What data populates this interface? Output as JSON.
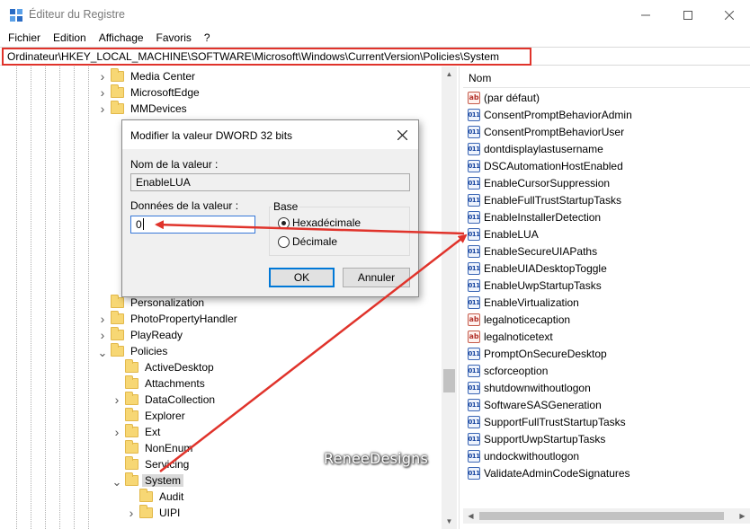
{
  "window": {
    "title": "Éditeur du Registre",
    "icons": {
      "app": "registry-editor-icon",
      "minimize": "minimize-icon",
      "maximize": "maximize-icon",
      "close": "close-icon"
    }
  },
  "menu": [
    "Fichier",
    "Edition",
    "Affichage",
    "Favoris",
    "?"
  ],
  "address": {
    "path": "Ordinateur\\HKEY_LOCAL_MACHINE\\SOFTWARE\\Microsoft\\Windows\\CurrentVersion\\Policies\\System"
  },
  "tree": {
    "items": [
      {
        "label": "Media Center",
        "expander": "collapsed",
        "selected": false
      },
      {
        "label": "MicrosoftEdge",
        "expander": "collapsed",
        "selected": false
      },
      {
        "label": "MMDevices",
        "expander": "collapsed",
        "selected": false
      },
      {
        "label": "Personalization",
        "expander": "none",
        "selected": false
      },
      {
        "label": "PhotoPropertyHandler",
        "expander": "collapsed",
        "selected": false
      },
      {
        "label": "PlayReady",
        "expander": "collapsed",
        "selected": false
      },
      {
        "label": "Policies",
        "expander": "expanded",
        "selected": false
      },
      {
        "label": "ActiveDesktop",
        "expander": "none",
        "selected": false
      },
      {
        "label": "Attachments",
        "expander": "none",
        "selected": false
      },
      {
        "label": "DataCollection",
        "expander": "collapsed",
        "selected": false
      },
      {
        "label": "Explorer",
        "expander": "none",
        "selected": false
      },
      {
        "label": "Ext",
        "expander": "collapsed",
        "selected": false
      },
      {
        "label": "NonEnum",
        "expander": "none",
        "selected": false
      },
      {
        "label": "Servicing",
        "expander": "none",
        "selected": false
      },
      {
        "label": "System",
        "expander": "expanded",
        "selected": true
      },
      {
        "label": "Audit",
        "expander": "none",
        "selected": false
      },
      {
        "label": "UIPI",
        "expander": "collapsed",
        "selected": false
      }
    ]
  },
  "values": {
    "column_name": "Nom",
    "items": [
      {
        "name": "(par défaut)",
        "type": "sz"
      },
      {
        "name": "ConsentPromptBehaviorAdmin",
        "type": "dword"
      },
      {
        "name": "ConsentPromptBehaviorUser",
        "type": "dword"
      },
      {
        "name": "dontdisplaylastusername",
        "type": "dword"
      },
      {
        "name": "DSCAutomationHostEnabled",
        "type": "dword"
      },
      {
        "name": "EnableCursorSuppression",
        "type": "dword"
      },
      {
        "name": "EnableFullTrustStartupTasks",
        "type": "dword"
      },
      {
        "name": "EnableInstallerDetection",
        "type": "dword"
      },
      {
        "name": "EnableLUA",
        "type": "dword"
      },
      {
        "name": "EnableSecureUIAPaths",
        "type": "dword"
      },
      {
        "name": "EnableUIADesktopToggle",
        "type": "dword"
      },
      {
        "name": "EnableUwpStartupTasks",
        "type": "dword"
      },
      {
        "name": "EnableVirtualization",
        "type": "dword"
      },
      {
        "name": "legalnoticecaption",
        "type": "sz"
      },
      {
        "name": "legalnoticetext",
        "type": "sz"
      },
      {
        "name": "PromptOnSecureDesktop",
        "type": "dword"
      },
      {
        "name": "scforceoption",
        "type": "dword"
      },
      {
        "name": "shutdownwithoutlogon",
        "type": "dword"
      },
      {
        "name": "SoftwareSASGeneration",
        "type": "dword"
      },
      {
        "name": "SupportFullTrustStartupTasks",
        "type": "dword"
      },
      {
        "name": "SupportUwpStartupTasks",
        "type": "dword"
      },
      {
        "name": "undockwithoutlogon",
        "type": "dword"
      },
      {
        "name": "ValidateAdminCodeSignatures",
        "type": "dword"
      }
    ],
    "icon_labels": {
      "sz": "ab",
      "dword": "011"
    }
  },
  "dialog": {
    "title": "Modifier la valeur DWORD 32 bits",
    "name_label": "Nom de la valeur :",
    "name_value": "EnableLUA",
    "data_label": "Données de la valeur :",
    "data_value": "0",
    "base_label": "Base",
    "radio_hex": "Hexadécimale",
    "radio_dec": "Décimale",
    "selected_base": "hex",
    "ok_label": "OK",
    "cancel_label": "Annuler"
  },
  "watermark": "ReneeDesigns",
  "colors": {
    "annotation": "#e0332b",
    "selection": "#d9d9d9",
    "focus": "#0078d7",
    "folder": "#f7d774"
  }
}
